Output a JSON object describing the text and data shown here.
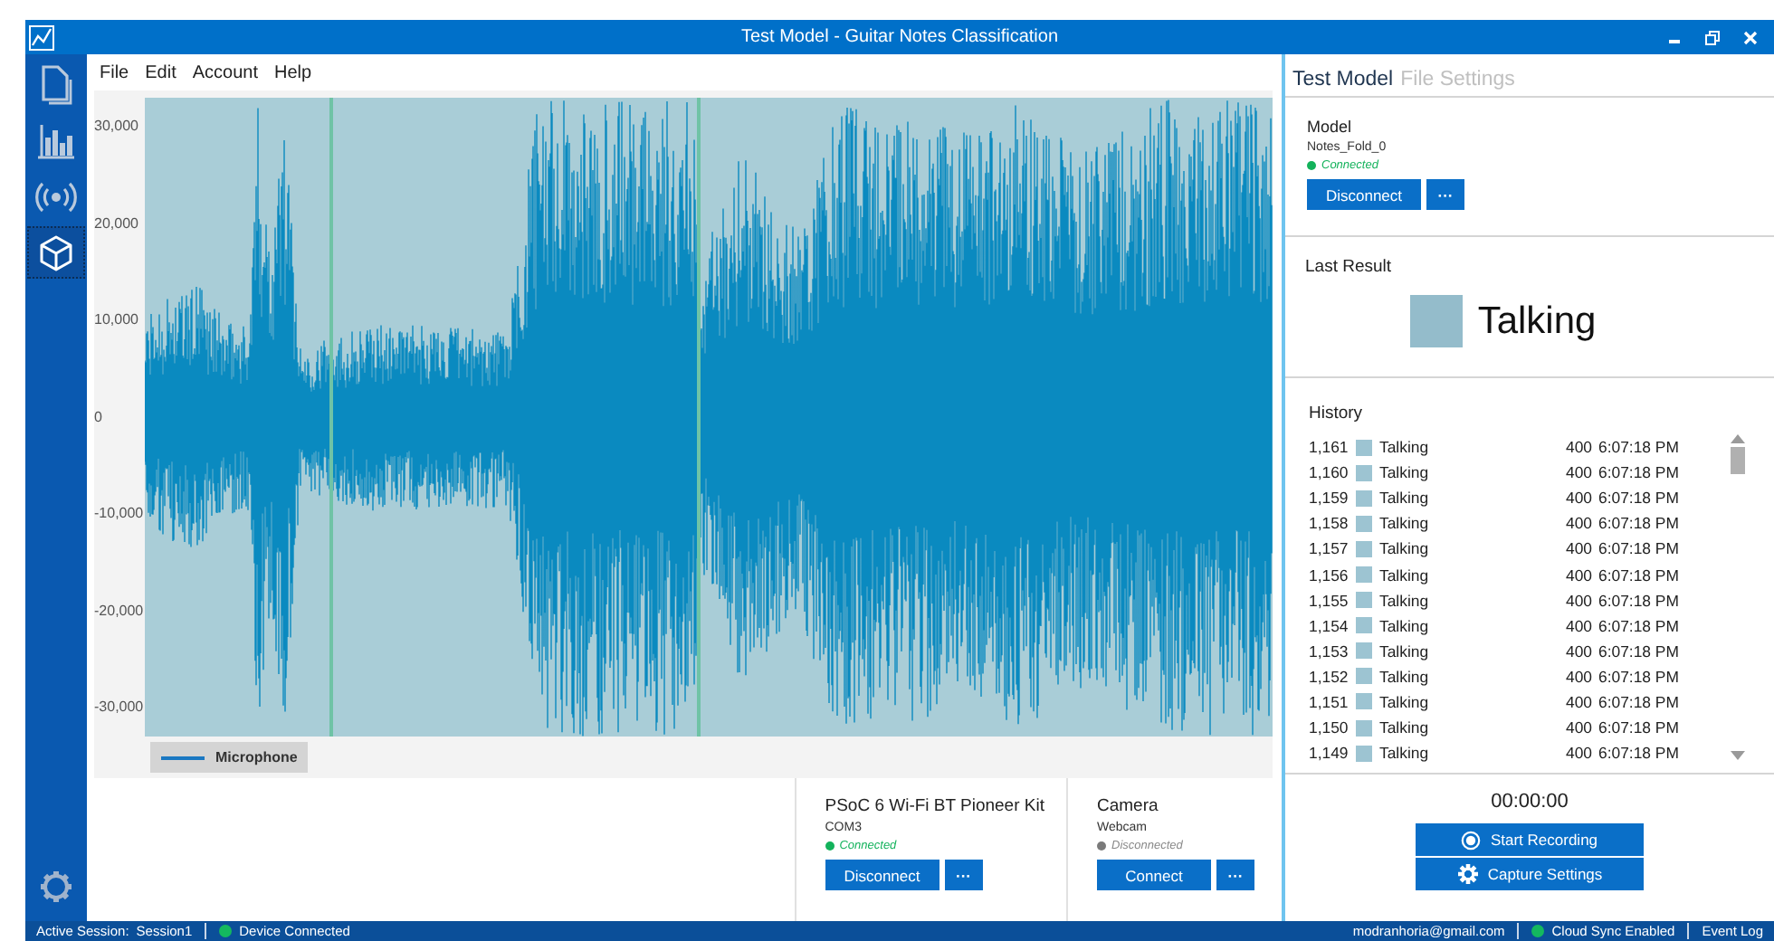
{
  "window": {
    "title": "Test Model - Guitar Notes Classification"
  },
  "sidebar": {
    "items": [
      {
        "kind": "document",
        "selected": false
      },
      {
        "kind": "chart",
        "selected": false
      },
      {
        "kind": "broadcast",
        "selected": false
      },
      {
        "kind": "cube",
        "selected": true
      }
    ]
  },
  "menu": [
    "File",
    "Edit",
    "Account",
    "Help"
  ],
  "chart": {
    "y_axis_labels": [
      "30,000",
      "20,000",
      "10,000",
      "0",
      "-10,000",
      "-20,000",
      "-30,000"
    ],
    "legend": "Microphone"
  },
  "devices": [
    {
      "name": "PSoC 6 Wi-Fi BT Pioneer Kit",
      "port": "COM3",
      "status": "Connected",
      "connected": true,
      "button": "Disconnect",
      "more": "···"
    },
    {
      "name": "Camera",
      "port": "Webcam",
      "status": "Disconnected",
      "connected": false,
      "button": "Connect",
      "more": "···"
    }
  ],
  "panel": {
    "tabs": [
      {
        "label": "Test Model",
        "selected": true
      },
      {
        "label": "File Settings",
        "selected": false
      }
    ],
    "model": {
      "heading": "Model",
      "name": "Notes_Fold_0",
      "status": "Connected",
      "connected": true,
      "button": "Disconnect",
      "more": "···"
    },
    "last_result": {
      "heading": "Last Result",
      "label": "Talking",
      "color": "#94bccb"
    },
    "history": {
      "heading": "History",
      "rows": [
        {
          "index": "1,161",
          "label": "Talking",
          "color": "#9dc4d2",
          "count": "400",
          "time": "6:07:18 PM"
        },
        {
          "index": "1,160",
          "label": "Talking",
          "color": "#9dc4d2",
          "count": "400",
          "time": "6:07:18 PM"
        },
        {
          "index": "1,159",
          "label": "Talking",
          "color": "#9dc4d2",
          "count": "400",
          "time": "6:07:18 PM"
        },
        {
          "index": "1,158",
          "label": "Talking",
          "color": "#9dc4d2",
          "count": "400",
          "time": "6:07:18 PM"
        },
        {
          "index": "1,157",
          "label": "Talking",
          "color": "#9dc4d2",
          "count": "400",
          "time": "6:07:18 PM"
        },
        {
          "index": "1,156",
          "label": "Talking",
          "color": "#9dc4d2",
          "count": "400",
          "time": "6:07:18 PM"
        },
        {
          "index": "1,155",
          "label": "Talking",
          "color": "#9dc4d2",
          "count": "400",
          "time": "6:07:18 PM"
        },
        {
          "index": "1,154",
          "label": "Talking",
          "color": "#9dc4d2",
          "count": "400",
          "time": "6:07:18 PM"
        },
        {
          "index": "1,153",
          "label": "Talking",
          "color": "#9dc4d2",
          "count": "400",
          "time": "6:07:18 PM"
        },
        {
          "index": "1,152",
          "label": "Talking",
          "color": "#9dc4d2",
          "count": "400",
          "time": "6:07:18 PM"
        },
        {
          "index": "1,151",
          "label": "Talking",
          "color": "#9dc4d2",
          "count": "400",
          "time": "6:07:18 PM"
        },
        {
          "index": "1,150",
          "label": "Talking",
          "color": "#9dc4d2",
          "count": "400",
          "time": "6:07:18 PM"
        },
        {
          "index": "1,149",
          "label": "Talking",
          "color": "#9dc4d2",
          "count": "400",
          "time": "6:07:18 PM"
        }
      ]
    },
    "timer": "00:00:00",
    "buttons": [
      {
        "kind": "record",
        "label": "Start Recording"
      },
      {
        "kind": "settings",
        "label": "Capture Settings"
      }
    ]
  },
  "status_bar": {
    "session_label": "Active Session:",
    "session": "Session1",
    "device_status": "Device Connected",
    "device_connected": true,
    "email": "modranhoria@gmail.com",
    "cloud_status": "Cloud Sync Enabled",
    "cloud_on": true,
    "event_log": "Event Log"
  }
}
